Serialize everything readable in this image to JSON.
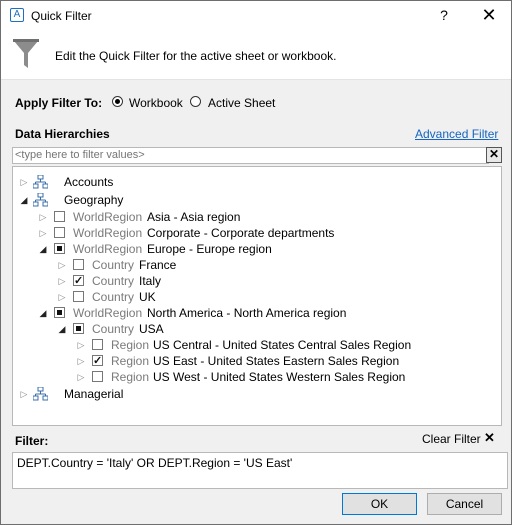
{
  "window": {
    "app_icon_letter": "A",
    "title": "Quick Filter",
    "help_label": "?",
    "close_label": "✕"
  },
  "header": {
    "description": "Edit the Quick Filter for the active sheet or workbook."
  },
  "apply_filter": {
    "label": "Apply Filter To:",
    "options": [
      {
        "label": "Workbook",
        "selected": true
      },
      {
        "label": "Active Sheet",
        "selected": false
      }
    ]
  },
  "hierarchies": {
    "label": "Data Hierarchies",
    "advanced_link": "Advanced Filter",
    "search_placeholder": "<type here to filter values>",
    "clear_search": "✕"
  },
  "tree": [
    {
      "label": "Accounts",
      "type": "hierarchy",
      "expanded": false
    },
    {
      "label": "Geography",
      "type": "hierarchy",
      "expanded": true
    },
    {
      "level": "WorldRegion",
      "label": "Asia - Asia region",
      "state": "unchecked",
      "expanded": false
    },
    {
      "level": "WorldRegion",
      "label": "Corporate - Corporate departments",
      "state": "unchecked",
      "expanded": false
    },
    {
      "level": "WorldRegion",
      "label": "Europe - Europe region",
      "state": "partial",
      "expanded": true
    },
    {
      "level": "Country",
      "label": "France",
      "state": "unchecked",
      "expanded": false
    },
    {
      "level": "Country",
      "label": "Italy",
      "state": "checked",
      "expanded": false
    },
    {
      "level": "Country",
      "label": "UK",
      "state": "unchecked",
      "expanded": false
    },
    {
      "level": "WorldRegion",
      "label": "North America - North America region",
      "state": "partial",
      "expanded": true
    },
    {
      "level": "Country",
      "label": "USA",
      "state": "partial",
      "expanded": true
    },
    {
      "level": "Region",
      "label": "US Central - United States Central Sales Region",
      "state": "unchecked",
      "expanded": false
    },
    {
      "level": "Region",
      "label": "US East - United States Eastern Sales Region",
      "state": "checked",
      "expanded": false
    },
    {
      "level": "Region",
      "label": "US West - United States Western Sales Region",
      "state": "unchecked",
      "expanded": false
    },
    {
      "label": "Managerial",
      "type": "hierarchy",
      "expanded": false
    }
  ],
  "filter": {
    "label": "Filter:",
    "clear_label": "Clear Filter",
    "clear_icon": "✕",
    "expression": "DEPT.Country = 'Italy' OR DEPT.Region = 'US East'"
  },
  "buttons": {
    "ok": "OK",
    "cancel": "Cancel"
  },
  "colors": {
    "link": "#1565c0",
    "level_text": "#7a7a7a",
    "dialog_bg": "#f0f0f0",
    "icon_blue": "#3b6ea8"
  }
}
